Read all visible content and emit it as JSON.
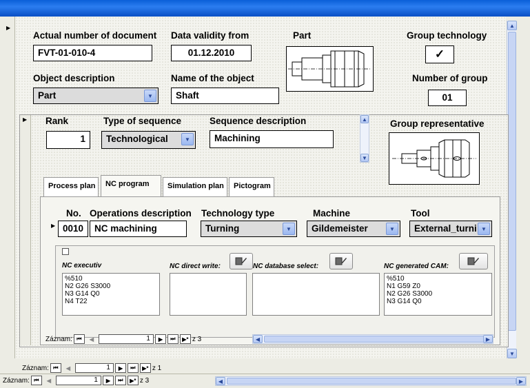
{
  "doc": {
    "number_label": "Actual number of document",
    "number_value": "FVT-01-010-4",
    "validity_label": "Data validity from",
    "validity_value": "01.12.2010",
    "part_label": "Part",
    "group_tech_label": "Group technology",
    "group_tech_checked": "✓",
    "object_desc_label": "Object description",
    "object_desc_value": "Part",
    "name_label": "Name of the object",
    "name_value": "Shaft",
    "group_number_label": "Number of group",
    "group_number_value": "01"
  },
  "sequence": {
    "rank_label": "Rank",
    "rank_value": "1",
    "type_label": "Type of sequence",
    "type_value": "Technological",
    "desc_label": "Sequence description",
    "desc_value": "Machining",
    "group_rep_label": "Group representative"
  },
  "tabs": [
    {
      "label": "Process plan"
    },
    {
      "label": "NC program"
    },
    {
      "label": "Simulation plan"
    },
    {
      "label": "Pictogram"
    }
  ],
  "operations": {
    "no_label": "No.",
    "desc_label": "Operations description",
    "tech_label": "Technology type",
    "machine_label": "Machine",
    "tool_label": "Tool",
    "no_value": "0010",
    "desc_value": "NC machining",
    "tech_value": "Turning",
    "machine_value": "Gildemeister",
    "tool_value": "External_turni"
  },
  "nc": {
    "executiv_label": "NC executiv",
    "executiv_text": "%510\nN2 G26 S3000\nN3 G14 Q0\nN4 T22",
    "direct_label": "NC direct write:",
    "database_label": "NC database select:",
    "cam_label": "NC generated CAM:",
    "cam_text": "%510\nN1 G59 Z0\nN2 G26 S3000\nN3 G14 Q0"
  },
  "nav": {
    "label": "Záznam:",
    "inner_current": "1",
    "inner_total": "z 3",
    "mid_current": "1",
    "mid_total": "z 1",
    "outer_current": "1",
    "outer_total": "z 3"
  },
  "icons": {
    "first": "⏮",
    "prev": "◀",
    "next": "▶",
    "last": "⏭",
    "new": "▶*"
  },
  "colors": {
    "titlebar": "#0a5fd8",
    "scroll": "#b4c8f4"
  }
}
